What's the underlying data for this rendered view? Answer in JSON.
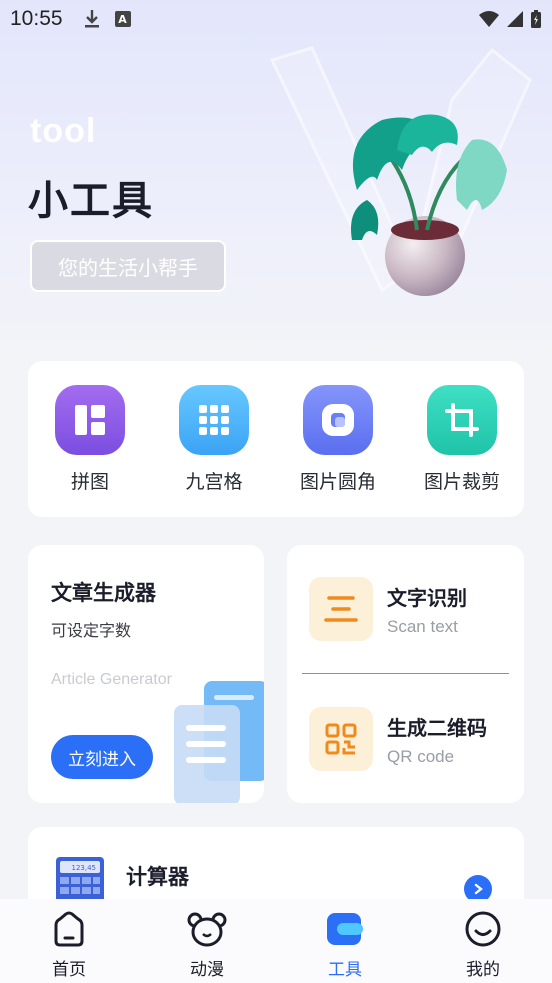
{
  "status_bar": {
    "time": "10:55",
    "a_badge": "A"
  },
  "hero": {
    "tag": "tool",
    "title": "小工具",
    "badge": "您的生活小帮手"
  },
  "tools": [
    {
      "label": "拼图",
      "icon": "collage-icon",
      "color": "#8b58e6"
    },
    {
      "label": "九宫格",
      "icon": "grid-nine-icon",
      "color": "#4bb3fa"
    },
    {
      "label": "图片圆角",
      "icon": "rounded-corner-icon",
      "color": "#6a7ef6"
    },
    {
      "label": "图片裁剪",
      "icon": "crop-icon",
      "color": "#2ed4b8"
    }
  ],
  "article": {
    "title": "文章生成器",
    "subtitle": "可设定字数",
    "english": "Article Generator",
    "button": "立刻进入"
  },
  "side": {
    "ocr": {
      "title": "文字识别",
      "subtitle": "Scan text",
      "icon": "text-lines-icon"
    },
    "qr": {
      "title": "生成二维码",
      "subtitle": "QR code",
      "icon": "qr-code-icon"
    }
  },
  "calculator": {
    "title": "计算器",
    "display": "123,45"
  },
  "nav": [
    {
      "label": "首页",
      "icon": "home-icon"
    },
    {
      "label": "动漫",
      "icon": "bear-icon"
    },
    {
      "label": "工具",
      "icon": "tools-icon",
      "active": true
    },
    {
      "label": "我的",
      "icon": "smile-profile-icon"
    }
  ],
  "colors": {
    "accent": "#2b6ff6",
    "orange": "#f08a1c"
  }
}
